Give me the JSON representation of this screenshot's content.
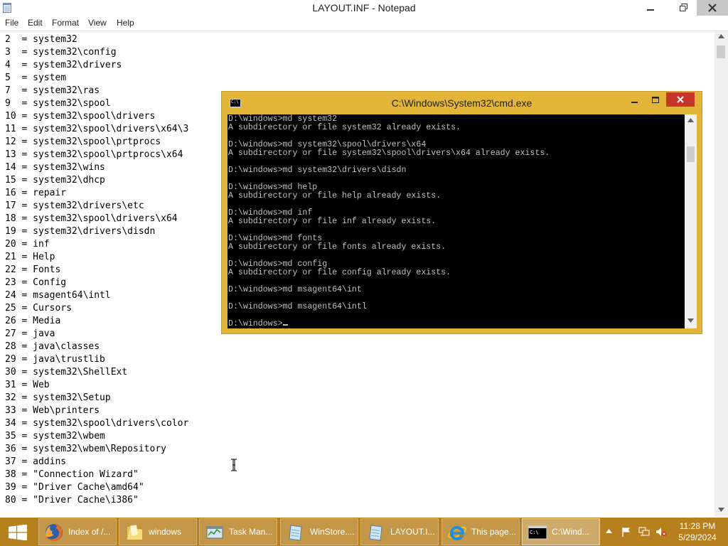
{
  "notepad": {
    "title": "LAYOUT.INF - Notepad",
    "menu": [
      "File",
      "Edit",
      "Format",
      "View",
      "Help"
    ],
    "lines": [
      "2  = system32",
      "3  = system32\\config",
      "4  = system32\\drivers",
      "5  = system",
      "7  = system32\\ras",
      "9  = system32\\spool",
      "10 = system32\\spool\\drivers",
      "11 = system32\\spool\\drivers\\x64\\3",
      "12 = system32\\spool\\prtprocs",
      "13 = system32\\spool\\prtprocs\\x64",
      "14 = system32\\wins",
      "15 = system32\\dhcp",
      "16 = repair",
      "17 = system32\\drivers\\etc",
      "18 = system32\\spool\\drivers\\x64",
      "19 = system32\\drivers\\disdn",
      "20 = inf",
      "21 = Help",
      "22 = Fonts",
      "23 = Config",
      "24 = msagent64\\intl",
      "25 = Cursors",
      "26 = Media",
      "27 = java",
      "28 = java\\classes",
      "29 = java\\trustlib",
      "30 = system32\\ShellExt",
      "31 = Web",
      "32 = system32\\Setup",
      "33 = Web\\printers",
      "34 = system32\\spool\\drivers\\color",
      "35 = system32\\wbem",
      "36 = system32\\wbem\\Repository",
      "37 = addins",
      "38 = \"Connection Wizard\"",
      "39 = \"Driver Cache\\amd64\"",
      "80 = \"Driver Cache\\i386\""
    ]
  },
  "cmd": {
    "title": "C:\\Windows\\System32\\cmd.exe",
    "icon_text": "C:\\",
    "lines": [
      "D:\\windows>md system32",
      "A subdirectory or file system32 already exists.",
      "",
      "D:\\windows>md system32\\spool\\drivers\\x64",
      "A subdirectory or file system32\\spool\\drivers\\x64 already exists.",
      "",
      "D:\\windows>md system32\\drivers\\disdn",
      "",
      "D:\\windows>md help",
      "A subdirectory or file help already exists.",
      "",
      "D:\\windows>md inf",
      "A subdirectory or file inf already exists.",
      "",
      "D:\\windows>md fonts",
      "A subdirectory or file fonts already exists.",
      "",
      "D:\\windows>md config",
      "A subdirectory or file config already exists.",
      "",
      "D:\\windows>md msagent64\\int",
      "",
      "D:\\windows>md msagent64\\intl",
      ""
    ],
    "prompt": "D:\\windows>"
  },
  "taskbar": {
    "buttons": [
      {
        "label": "Index of /...",
        "icon": "firefox-icon"
      },
      {
        "label": "windows",
        "icon": "folder-icon"
      },
      {
        "label": "Task Man...",
        "icon": "task-manager-icon"
      },
      {
        "label": "WinStore....",
        "icon": "notepad-icon"
      },
      {
        "label": "LAYOUT.I...",
        "icon": "notepad-icon"
      },
      {
        "label": "This page...",
        "icon": "internet-explorer-icon"
      },
      {
        "label": "C:\\Wind...",
        "icon": "cmd-icon"
      }
    ],
    "clock_time": "11:28 PM",
    "clock_date": "5/29/2024"
  },
  "colors": {
    "taskbar": "#b6801f",
    "cmd_frame": "#e2b438",
    "close_red": "#c7342b"
  }
}
